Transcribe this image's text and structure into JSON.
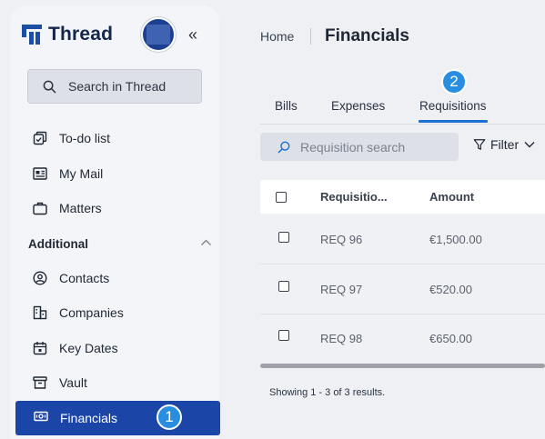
{
  "app": {
    "name": "Thread"
  },
  "sidebar": {
    "search_placeholder": "Search in Thread",
    "items": [
      {
        "label": "To-do list",
        "icon": "todo-icon"
      },
      {
        "label": "My Mail",
        "icon": "mail-icon"
      },
      {
        "label": "Matters",
        "icon": "briefcase-icon"
      }
    ],
    "section_label": "Additional",
    "additional_items": [
      {
        "label": "Contacts",
        "icon": "contact-icon"
      },
      {
        "label": "Companies",
        "icon": "building-icon"
      },
      {
        "label": "Key Dates",
        "icon": "calendar-icon"
      },
      {
        "label": "Vault",
        "icon": "archive-icon"
      }
    ],
    "active_item": {
      "label": "Financials",
      "icon": "money-icon"
    }
  },
  "badges": {
    "sidebar": "1",
    "tabs": "2"
  },
  "header": {
    "breadcrumb_home": "Home",
    "title": "Financials"
  },
  "tabs": [
    {
      "label": "Bills"
    },
    {
      "label": "Expenses"
    },
    {
      "label": "Requisitions",
      "active": true
    }
  ],
  "toolbar": {
    "search_placeholder": "Requisition search",
    "filter_label": "Filter"
  },
  "table": {
    "columns": [
      "Requisitio...",
      "Amount"
    ],
    "rows": [
      {
        "id": "REQ 96",
        "amount": "€1,500.00"
      },
      {
        "id": "REQ 97",
        "amount": "€520.00"
      },
      {
        "id": "REQ 98",
        "amount": "€650.00"
      }
    ]
  },
  "footer": {
    "results_text": "Showing 1 - 3 of 3 results."
  },
  "colors": {
    "accent": "#1b45a6",
    "badge": "#2a8ee0",
    "tab_underline": "#1b6fd0"
  }
}
